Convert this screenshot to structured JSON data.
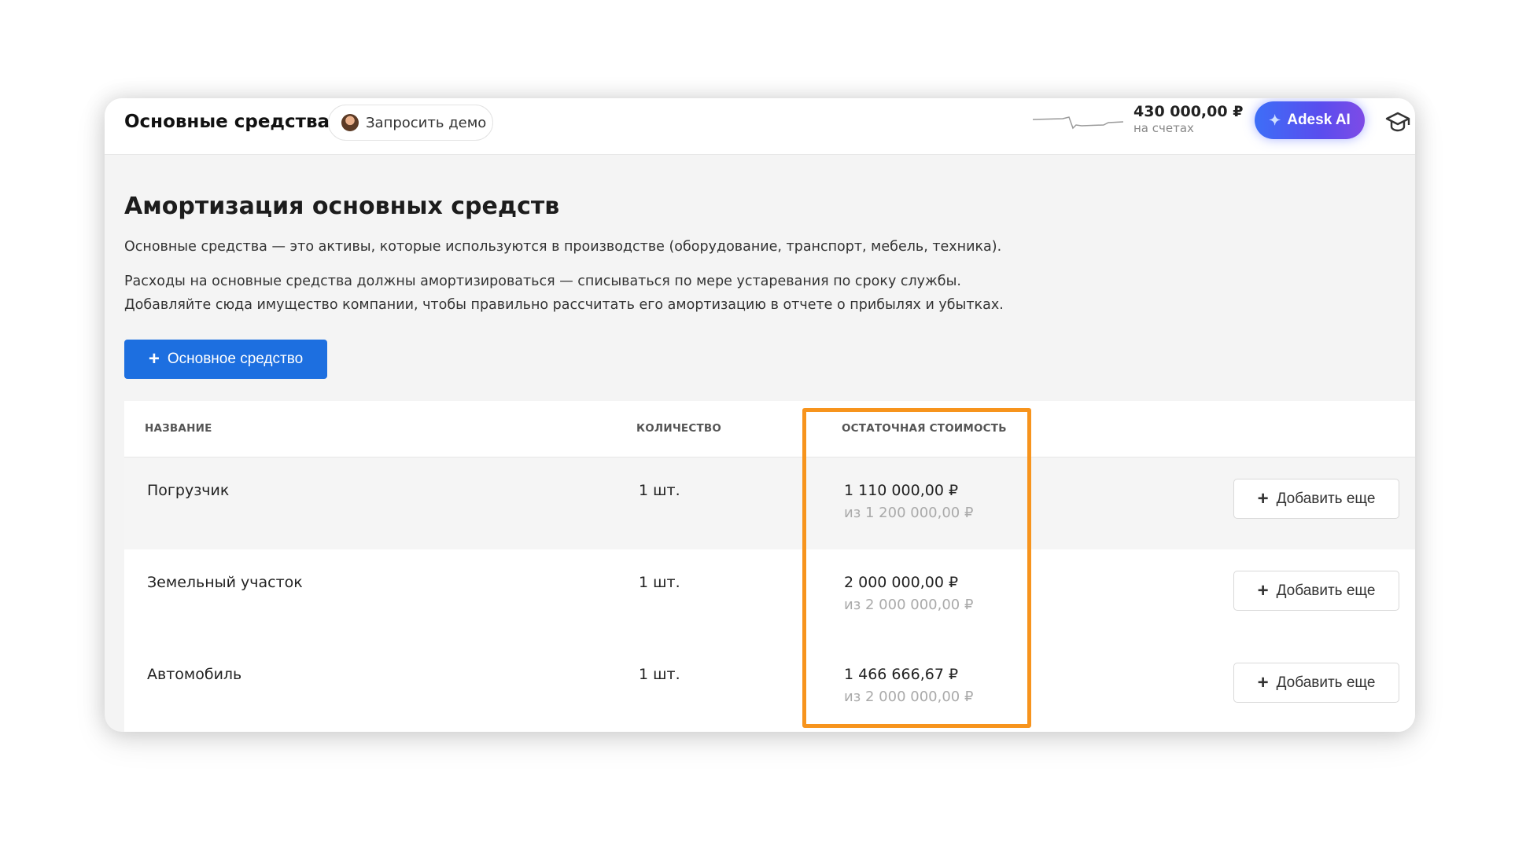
{
  "header": {
    "app_title": "Основные средства",
    "demo_label": "Запросить демо",
    "balance_amount": "430 000,00 ₽",
    "balance_caption": "на счетах",
    "ai_label": "Adesk AI",
    "icons": [
      "avatar",
      "sparkline",
      "sparkle-icon",
      "graduation-cap-icon"
    ]
  },
  "main": {
    "heading": "Амортизация основных средств",
    "desc_1": "Основные средства — это активы, которые используются в производстве (оборудование, транспорт, мебель, техника).",
    "desc_2": "Расходы на основные средства должны амортизироваться — списываться по мере устаревания по сроку службы.",
    "desc_3": "Добавляйте сюда имущество компании, чтобы правильно рассчитать его амортизацию в отчете о прибылях и убытках.",
    "add_button": "Основное средство"
  },
  "table": {
    "columns": {
      "name": "НАЗВАНИЕ",
      "qty": "КОЛИЧЕСТВО",
      "residual": "ОСТАТОЧНАЯ СТОИМОСТЬ"
    },
    "rows": [
      {
        "name": "Погрузчик",
        "qty": "1 шт.",
        "value": "1 110 000,00 ₽",
        "of": "из 1 200 000,00 ₽",
        "action": "Добавить еще"
      },
      {
        "name": "Земельный участок",
        "qty": "1 шт.",
        "value": "2 000 000,00 ₽",
        "of": "из 2 000 000,00 ₽",
        "action": "Добавить еще"
      },
      {
        "name": "Автомобиль",
        "qty": "1 шт.",
        "value": "1 466 666,67 ₽",
        "of": "из 2 000 000,00 ₽",
        "action": "Добавить еще"
      }
    ]
  },
  "colors": {
    "primary": "#1d6fe0",
    "highlight": "#f7941d",
    "ai_gradient_start": "#3d6ef7",
    "ai_gradient_end": "#7e4be6"
  }
}
